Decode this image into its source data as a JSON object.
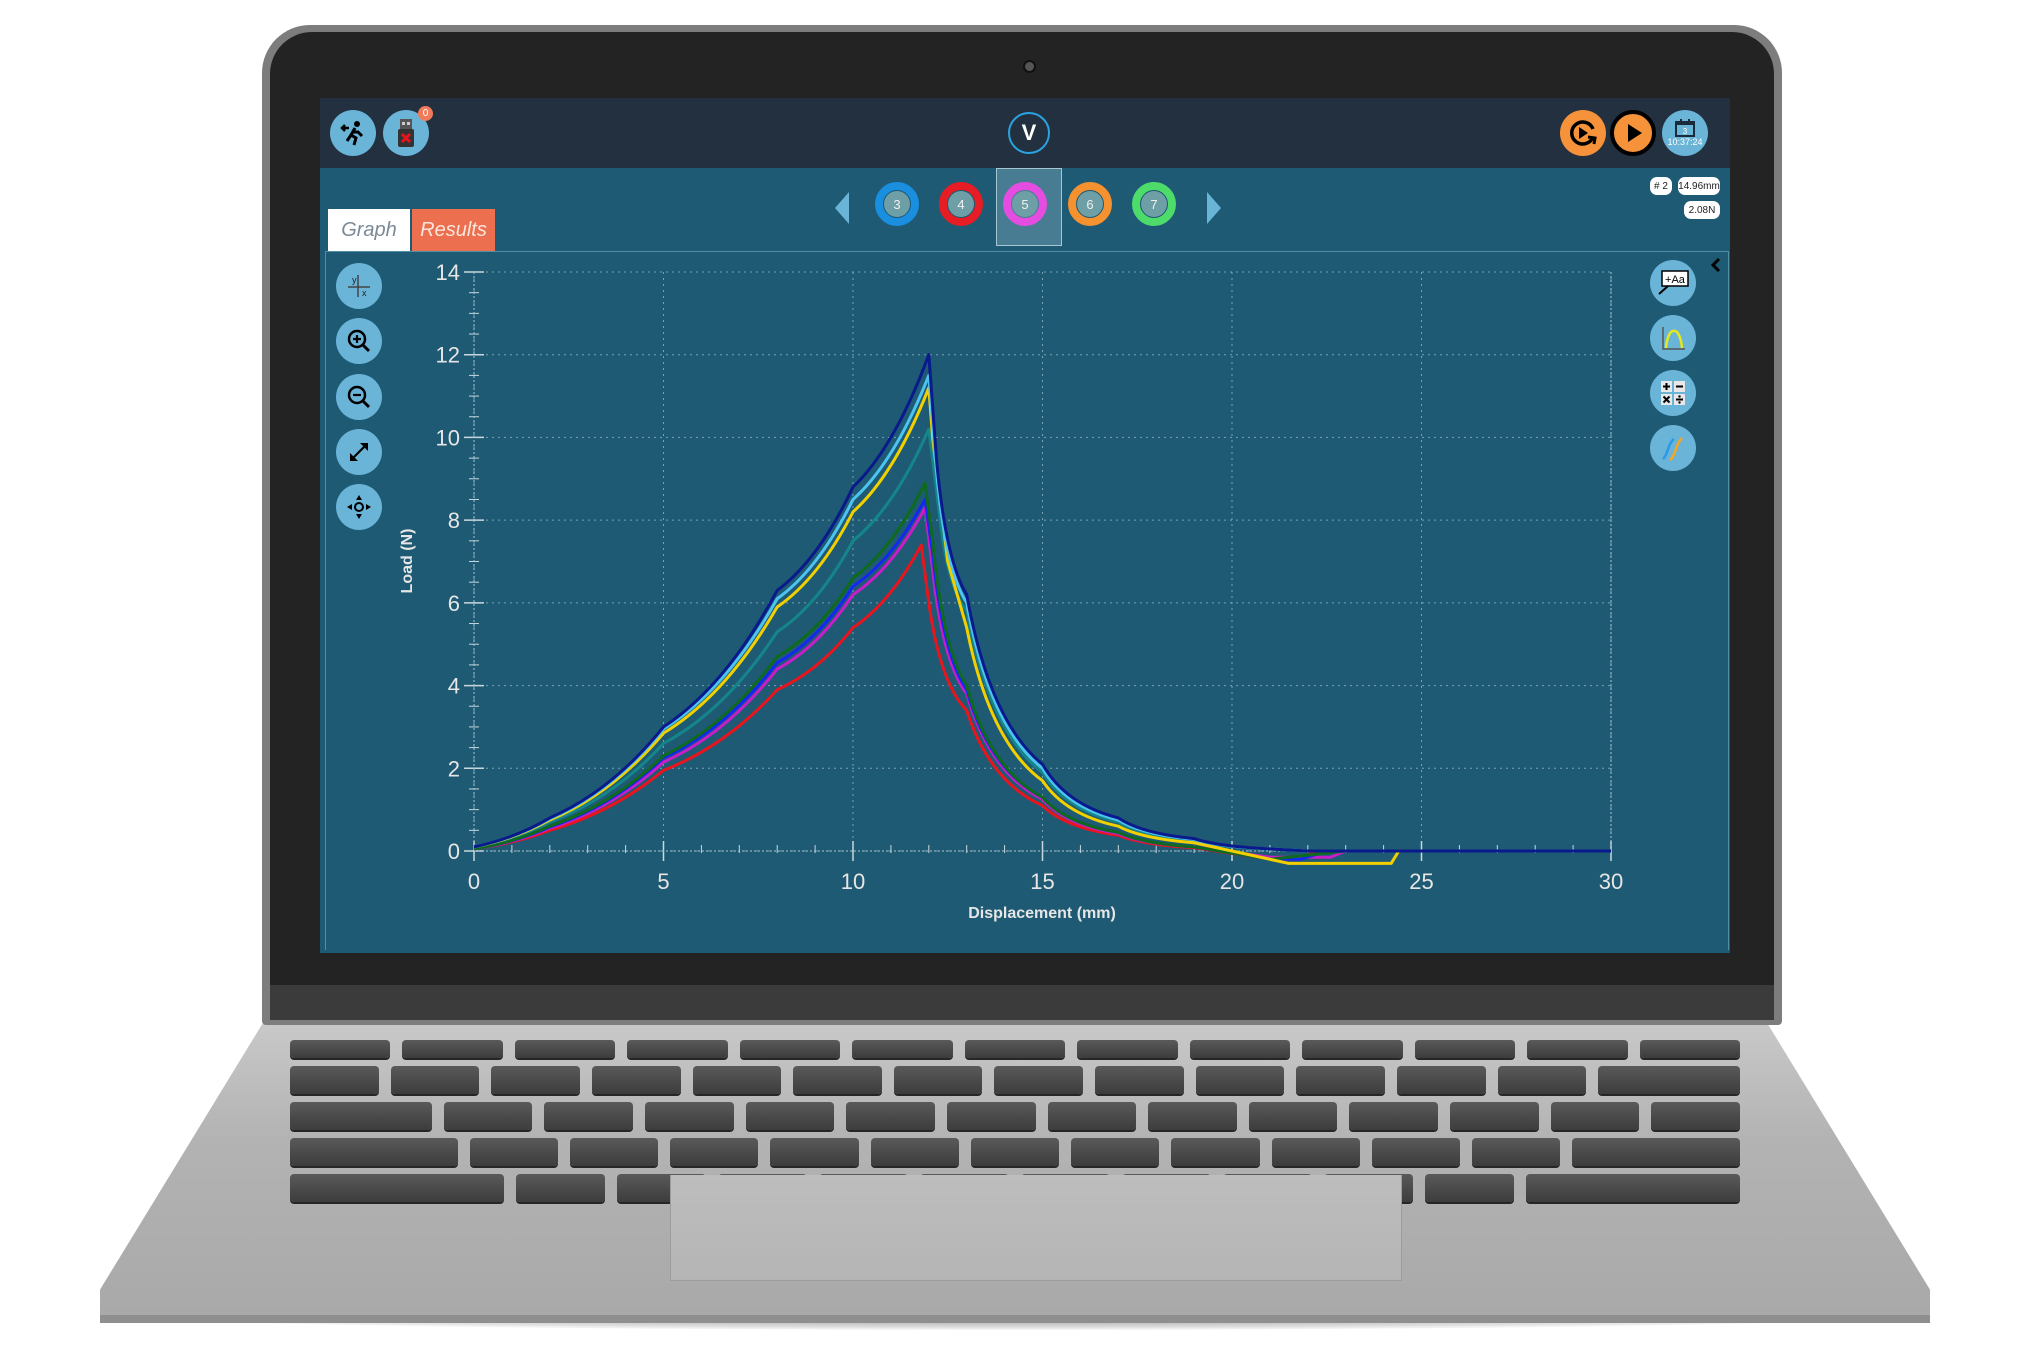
{
  "topbar": {
    "exit_label": "Exit",
    "usb_badge": "0",
    "logo_text": "V",
    "date_day": "3",
    "time": "10:37:24"
  },
  "samples": {
    "items": [
      {
        "label": "3",
        "color": "#1a8fe0"
      },
      {
        "label": "4",
        "color": "#e81c24"
      },
      {
        "label": "5",
        "color": "#e54ce0"
      },
      {
        "label": "6",
        "color": "#f5922f"
      },
      {
        "label": "7",
        "color": "#4ddc6a"
      }
    ],
    "selected": "5"
  },
  "readouts": {
    "index": "# 2",
    "displacement": "14.96mm",
    "load": "2.08N"
  },
  "tabs": [
    {
      "label": "Graph",
      "active": true
    },
    {
      "label": "Results",
      "active": false
    }
  ],
  "left_tools": [
    "axis-select",
    "zoom-in",
    "zoom-out",
    "fit-to-screen",
    "pan"
  ],
  "right_tools": [
    "add-annotation",
    "curve-fit",
    "calculator",
    "overlay-curves"
  ],
  "chart_data": {
    "type": "line",
    "title": "",
    "xlabel": "Displacement (mm)",
    "ylabel": "Load (N)",
    "xlim": [
      0,
      30
    ],
    "ylim": [
      0,
      14
    ],
    "xticks": [
      0,
      5,
      10,
      15,
      20,
      25,
      30
    ],
    "yticks": [
      0,
      2,
      4,
      6,
      8,
      10,
      12,
      14
    ],
    "grid": true,
    "legend": "none",
    "series": [
      {
        "name": "navy",
        "color": "#0a1a8c",
        "peak_x": 12.0,
        "peak_y": 12.0,
        "points": [
          [
            0,
            0.1
          ],
          [
            2,
            0.8
          ],
          [
            5,
            3.0
          ],
          [
            8,
            6.3
          ],
          [
            10,
            8.8
          ],
          [
            12,
            12.0
          ],
          [
            12.2,
            9.5
          ],
          [
            13,
            6.2
          ],
          [
            15,
            2.1
          ],
          [
            17,
            0.8
          ],
          [
            19,
            0.3
          ],
          [
            21,
            0.05
          ],
          [
            22,
            0
          ],
          [
            30,
            0
          ]
        ]
      },
      {
        "name": "light-blue",
        "color": "#4cc3f0",
        "peak_x": 12.0,
        "peak_y": 11.5,
        "points": [
          [
            0,
            0.1
          ],
          [
            2,
            0.78
          ],
          [
            5,
            2.95
          ],
          [
            8,
            6.1
          ],
          [
            10,
            8.5
          ],
          [
            12,
            11.5
          ],
          [
            12.2,
            9.2
          ],
          [
            13,
            6.0
          ],
          [
            15,
            2.0
          ],
          [
            17,
            0.75
          ],
          [
            19,
            0.28
          ],
          [
            21,
            0.05
          ],
          [
            22,
            0
          ],
          [
            30,
            0
          ]
        ]
      },
      {
        "name": "yellow",
        "color": "#f2d000",
        "peak_x": 12.0,
        "peak_y": 11.2,
        "points": [
          [
            0,
            0.1
          ],
          [
            2,
            0.75
          ],
          [
            5,
            2.85
          ],
          [
            8,
            5.9
          ],
          [
            10,
            8.2
          ],
          [
            12,
            11.2
          ],
          [
            12.1,
            10.0
          ],
          [
            12.5,
            7.0
          ],
          [
            13,
            5.4
          ],
          [
            15,
            1.7
          ],
          [
            17,
            0.6
          ],
          [
            19,
            0.2
          ],
          [
            21,
            -0.2
          ],
          [
            21.5,
            -0.3
          ],
          [
            24.2,
            -0.3
          ],
          [
            24.4,
            0
          ],
          [
            30,
            0
          ]
        ]
      },
      {
        "name": "teal",
        "color": "#14868a",
        "peak_x": 12.0,
        "peak_y": 10.2,
        "points": [
          [
            0,
            0.1
          ],
          [
            2,
            0.7
          ],
          [
            5,
            2.6
          ],
          [
            8,
            5.3
          ],
          [
            10,
            7.5
          ],
          [
            12,
            10.2
          ],
          [
            12.3,
            8.0
          ],
          [
            13,
            5.8
          ],
          [
            15,
            1.9
          ],
          [
            17,
            0.7
          ],
          [
            19,
            0.25
          ],
          [
            21,
            0.05
          ],
          [
            22,
            0
          ],
          [
            30,
            0
          ]
        ]
      },
      {
        "name": "green",
        "color": "#0e6a1e",
        "peak_x": 11.9,
        "peak_y": 8.9,
        "points": [
          [
            0,
            0.05
          ],
          [
            2,
            0.6
          ],
          [
            5,
            2.3
          ],
          [
            8,
            4.7
          ],
          [
            10,
            6.6
          ],
          [
            11.9,
            8.9
          ],
          [
            12.1,
            7.5
          ],
          [
            13,
            4.0
          ],
          [
            15,
            1.3
          ],
          [
            17,
            0.45
          ],
          [
            19,
            0.1
          ],
          [
            21,
            -0.2
          ],
          [
            22,
            -0.1
          ],
          [
            23,
            0
          ],
          [
            30,
            0
          ]
        ]
      },
      {
        "name": "blue",
        "color": "#1428f0",
        "peak_x": 11.9,
        "peak_y": 8.5,
        "points": [
          [
            0,
            0.05
          ],
          [
            2,
            0.58
          ],
          [
            5,
            2.25
          ],
          [
            8,
            4.55
          ],
          [
            10,
            6.4
          ],
          [
            11.9,
            8.5
          ],
          [
            12.1,
            7.2
          ],
          [
            13,
            3.9
          ],
          [
            15,
            1.3
          ],
          [
            17,
            0.45
          ],
          [
            19,
            0.1
          ],
          [
            21,
            -0.2
          ],
          [
            21.8,
            -0.2
          ],
          [
            22.5,
            0
          ],
          [
            30,
            0
          ]
        ]
      },
      {
        "name": "magenta",
        "color": "#c81ec8",
        "peak_x": 11.9,
        "peak_y": 8.3,
        "points": [
          [
            0,
            0.05
          ],
          [
            2,
            0.55
          ],
          [
            5,
            2.15
          ],
          [
            8,
            4.4
          ],
          [
            10,
            6.2
          ],
          [
            11.9,
            8.3
          ],
          [
            12.1,
            6.8
          ],
          [
            13,
            3.8
          ],
          [
            15,
            1.25
          ],
          [
            17,
            0.42
          ],
          [
            19,
            0.1
          ],
          [
            21,
            -0.15
          ],
          [
            22.6,
            -0.15
          ],
          [
            23,
            0
          ],
          [
            30,
            0
          ]
        ]
      },
      {
        "name": "red",
        "color": "#e8141e",
        "peak_x": 11.8,
        "peak_y": 7.4,
        "points": [
          [
            0,
            0.05
          ],
          [
            2,
            0.5
          ],
          [
            5,
            1.95
          ],
          [
            8,
            3.9
          ],
          [
            10,
            5.4
          ],
          [
            11.8,
            7.4
          ],
          [
            12.0,
            6.0
          ],
          [
            13,
            3.4
          ],
          [
            15,
            1.1
          ],
          [
            17,
            0.38
          ],
          [
            19,
            0.08
          ],
          [
            21,
            -0.2
          ],
          [
            21.7,
            -0.2
          ],
          [
            22.3,
            0
          ],
          [
            30,
            0
          ]
        ]
      }
    ]
  }
}
